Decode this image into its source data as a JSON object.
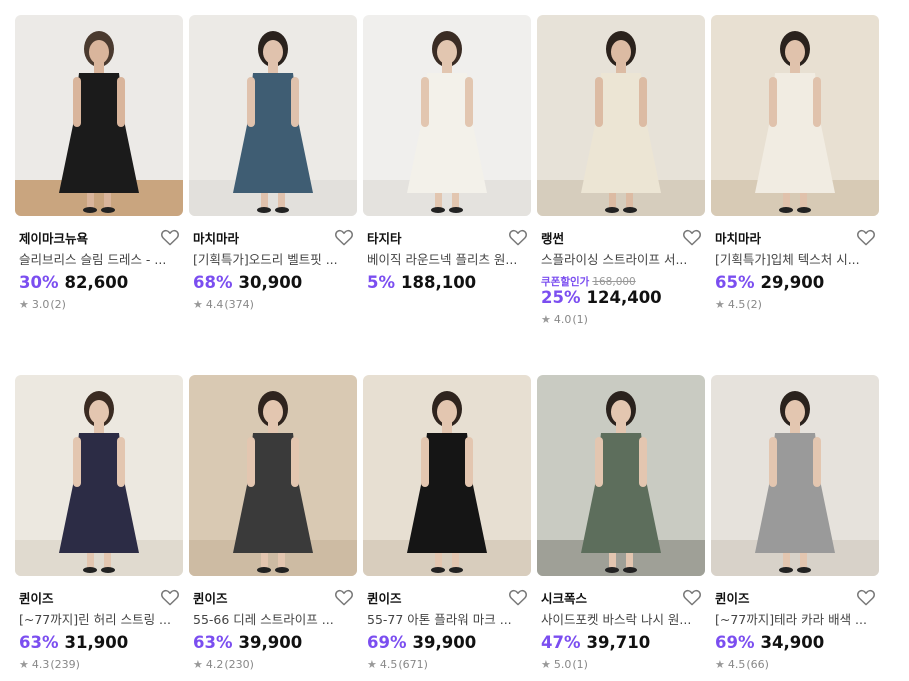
{
  "products": [
    {
      "brand": "제이마크뉴욕",
      "title": "슬리브리스 슬림 드레스 - ...",
      "discount": "30%",
      "price": "82,600",
      "rating": "3.0",
      "reviews": "(2)",
      "bg": "#eceae7",
      "floor": "#c9a57f",
      "dress": "#1b1b1b",
      "skin": "#d9b59c",
      "hair": "#4a3a2f"
    },
    {
      "brand": "마치마라",
      "title": "[기획특가]오드리 벨트핏 ...",
      "discount": "68%",
      "price": "30,900",
      "rating": "4.4",
      "reviews": "(374)",
      "bg": "#eceae6",
      "floor": "#e2e0dc",
      "dress": "#3f5d73",
      "skin": "#e0c2ad",
      "hair": "#2a221d"
    },
    {
      "brand": "타지타",
      "title": "베이직 라운드넥 플리츠 원...",
      "discount": "5%",
      "price": "188,100",
      "rating": "",
      "reviews": "",
      "bg": "#f0efed",
      "floor": "#e4e2de",
      "dress": "#f3f1ea",
      "skin": "#e2c6b0",
      "hair": "#3a2c24"
    },
    {
      "brand": "랭썬",
      "title": "스플라이싱 스트라이프 서...",
      "coupon_label": "쿠폰할인가",
      "original_price": "168,000",
      "discount": "25%",
      "price": "124,400",
      "rating": "4.0",
      "reviews": "(1)",
      "bg": "#e7e2d8",
      "floor": "#d6cdbd",
      "dress": "#ece5d4",
      "skin": "#dcbba3",
      "hair": "#2b221c"
    },
    {
      "brand": "마치마라",
      "title": "[기획특가]입체 텍스처 시...",
      "discount": "65%",
      "price": "29,900",
      "rating": "4.5",
      "reviews": "(2)",
      "bg": "#e8e0d2",
      "floor": "#d7cab5",
      "dress": "#f1ece2",
      "skin": "#e0c2ac",
      "hair": "#2a221d"
    },
    {
      "brand": "퀸이즈",
      "title": "[~77까지]린 허리 스트링 ...",
      "discount": "63%",
      "price": "31,900",
      "rating": "4.3",
      "reviews": "(239)",
      "bg": "#ece8e0",
      "floor": "#e0dacf",
      "dress": "#2c2c45",
      "skin": "#e3c6b0",
      "hair": "#3a2b22"
    },
    {
      "brand": "퀸이즈",
      "title": "55-66 디레 스트라이프 ...",
      "discount": "63%",
      "price": "39,900",
      "rating": "4.2",
      "reviews": "(230)",
      "bg": "#d9c9b3",
      "floor": "#cdbba3",
      "dress": "#3a3a3a",
      "skin": "#e3c6b0",
      "hair": "#2f241e"
    },
    {
      "brand": "퀸이즈",
      "title": "55-77 아톤 플라워 마크 ...",
      "discount": "69%",
      "price": "39,900",
      "rating": "4.5",
      "reviews": "(671)",
      "bg": "#e7dfd2",
      "floor": "#d8cdbd",
      "dress": "#151515",
      "skin": "#e3c6b0",
      "hair": "#2f241e"
    },
    {
      "brand": "시크폭스",
      "title": "사이드포켓 바스락 나시 원...",
      "discount": "47%",
      "price": "39,710",
      "rating": "5.0",
      "reviews": "(1)",
      "bg": "#c9cbc2",
      "floor": "#9fa097",
      "dress": "#5d6e5c",
      "skin": "#e3c6b0",
      "hair": "#2a221d"
    },
    {
      "brand": "퀸이즈",
      "title": "[~77까지]테라 카라 배색 ...",
      "discount": "69%",
      "price": "34,900",
      "rating": "4.5",
      "reviews": "(66)",
      "bg": "#e6e2dc",
      "floor": "#d8d2c9",
      "dress": "#9a9a9a",
      "skin": "#e3c6b0",
      "hair": "#2a221d"
    }
  ],
  "colors": {
    "accent": "#7b4ef0",
    "text": "#111111",
    "muted": "#888888"
  }
}
